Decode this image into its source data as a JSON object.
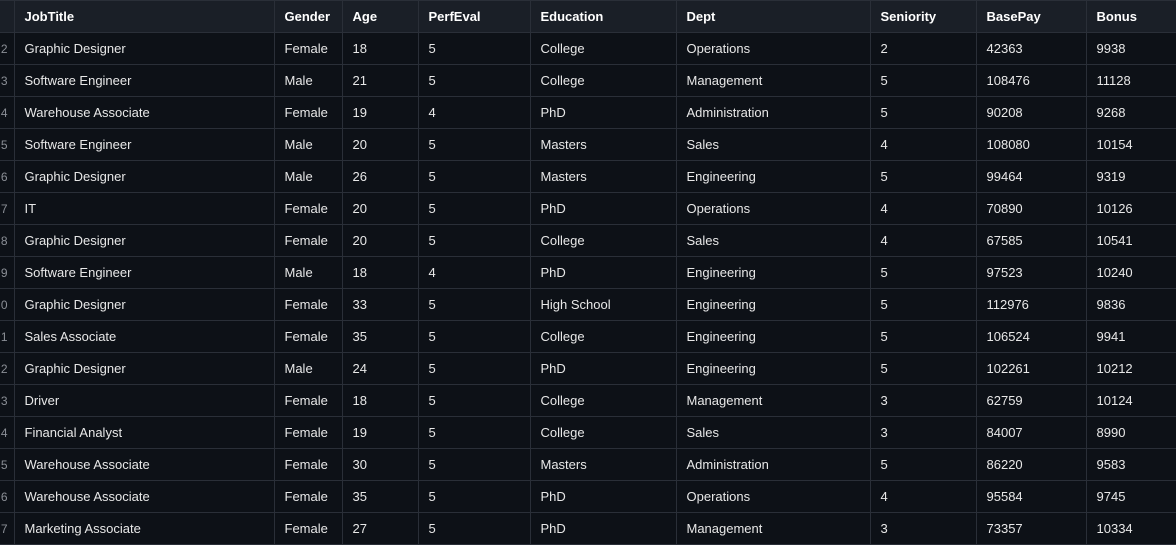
{
  "table": {
    "headers": {
      "jobtitle": "JobTitle",
      "gender": "Gender",
      "age": "Age",
      "perfeval": "PerfEval",
      "education": "Education",
      "dept": "Dept",
      "seniority": "Seniority",
      "basepay": "BasePay",
      "bonus": "Bonus"
    },
    "start_row_index": 2,
    "rows": [
      {
        "num": "2",
        "jobtitle": "Graphic Designer",
        "gender": "Female",
        "age": "18",
        "perfeval": "5",
        "education": "College",
        "dept": "Operations",
        "seniority": "2",
        "basepay": "42363",
        "bonus": "9938"
      },
      {
        "num": "3",
        "jobtitle": "Software Engineer",
        "gender": "Male",
        "age": "21",
        "perfeval": "5",
        "education": "College",
        "dept": "Management",
        "seniority": "5",
        "basepay": "108476",
        "bonus": "11128"
      },
      {
        "num": "4",
        "jobtitle": "Warehouse Associate",
        "gender": "Female",
        "age": "19",
        "perfeval": "4",
        "education": "PhD",
        "dept": "Administration",
        "seniority": "5",
        "basepay": "90208",
        "bonus": "9268"
      },
      {
        "num": "5",
        "jobtitle": "Software Engineer",
        "gender": "Male",
        "age": "20",
        "perfeval": "5",
        "education": "Masters",
        "dept": "Sales",
        "seniority": "4",
        "basepay": "108080",
        "bonus": "10154"
      },
      {
        "num": "6",
        "jobtitle": "Graphic Designer",
        "gender": "Male",
        "age": "26",
        "perfeval": "5",
        "education": "Masters",
        "dept": "Engineering",
        "seniority": "5",
        "basepay": "99464",
        "bonus": "9319"
      },
      {
        "num": "7",
        "jobtitle": "IT",
        "gender": "Female",
        "age": "20",
        "perfeval": "5",
        "education": "PhD",
        "dept": "Operations",
        "seniority": "4",
        "basepay": "70890",
        "bonus": "10126"
      },
      {
        "num": "8",
        "jobtitle": "Graphic Designer",
        "gender": "Female",
        "age": "20",
        "perfeval": "5",
        "education": "College",
        "dept": "Sales",
        "seniority": "4",
        "basepay": "67585",
        "bonus": "10541"
      },
      {
        "num": "9",
        "jobtitle": "Software Engineer",
        "gender": "Male",
        "age": "18",
        "perfeval": "4",
        "education": "PhD",
        "dept": "Engineering",
        "seniority": "5",
        "basepay": "97523",
        "bonus": "10240"
      },
      {
        "num": "0",
        "jobtitle": "Graphic Designer",
        "gender": "Female",
        "age": "33",
        "perfeval": "5",
        "education": "High School",
        "dept": "Engineering",
        "seniority": "5",
        "basepay": "112976",
        "bonus": "9836"
      },
      {
        "num": "1",
        "jobtitle": "Sales Associate",
        "gender": "Female",
        "age": "35",
        "perfeval": "5",
        "education": "College",
        "dept": "Engineering",
        "seniority": "5",
        "basepay": "106524",
        "bonus": "9941"
      },
      {
        "num": "2",
        "jobtitle": "Graphic Designer",
        "gender": "Male",
        "age": "24",
        "perfeval": "5",
        "education": "PhD",
        "dept": "Engineering",
        "seniority": "5",
        "basepay": "102261",
        "bonus": "10212"
      },
      {
        "num": "3",
        "jobtitle": "Driver",
        "gender": "Female",
        "age": "18",
        "perfeval": "5",
        "education": "College",
        "dept": "Management",
        "seniority": "3",
        "basepay": "62759",
        "bonus": "10124"
      },
      {
        "num": "4",
        "jobtitle": "Financial Analyst",
        "gender": "Female",
        "age": "19",
        "perfeval": "5",
        "education": "College",
        "dept": "Sales",
        "seniority": "3",
        "basepay": "84007",
        "bonus": "8990"
      },
      {
        "num": "5",
        "jobtitle": "Warehouse Associate",
        "gender": "Female",
        "age": "30",
        "perfeval": "5",
        "education": "Masters",
        "dept": "Administration",
        "seniority": "5",
        "basepay": "86220",
        "bonus": "9583"
      },
      {
        "num": "6",
        "jobtitle": "Warehouse Associate",
        "gender": "Female",
        "age": "35",
        "perfeval": "5",
        "education": "PhD",
        "dept": "Operations",
        "seniority": "4",
        "basepay": "95584",
        "bonus": "9745"
      },
      {
        "num": "7",
        "jobtitle": "Marketing Associate",
        "gender": "Female",
        "age": "27",
        "perfeval": "5",
        "education": "PhD",
        "dept": "Management",
        "seniority": "3",
        "basepay": "73357",
        "bonus": "10334"
      }
    ]
  }
}
